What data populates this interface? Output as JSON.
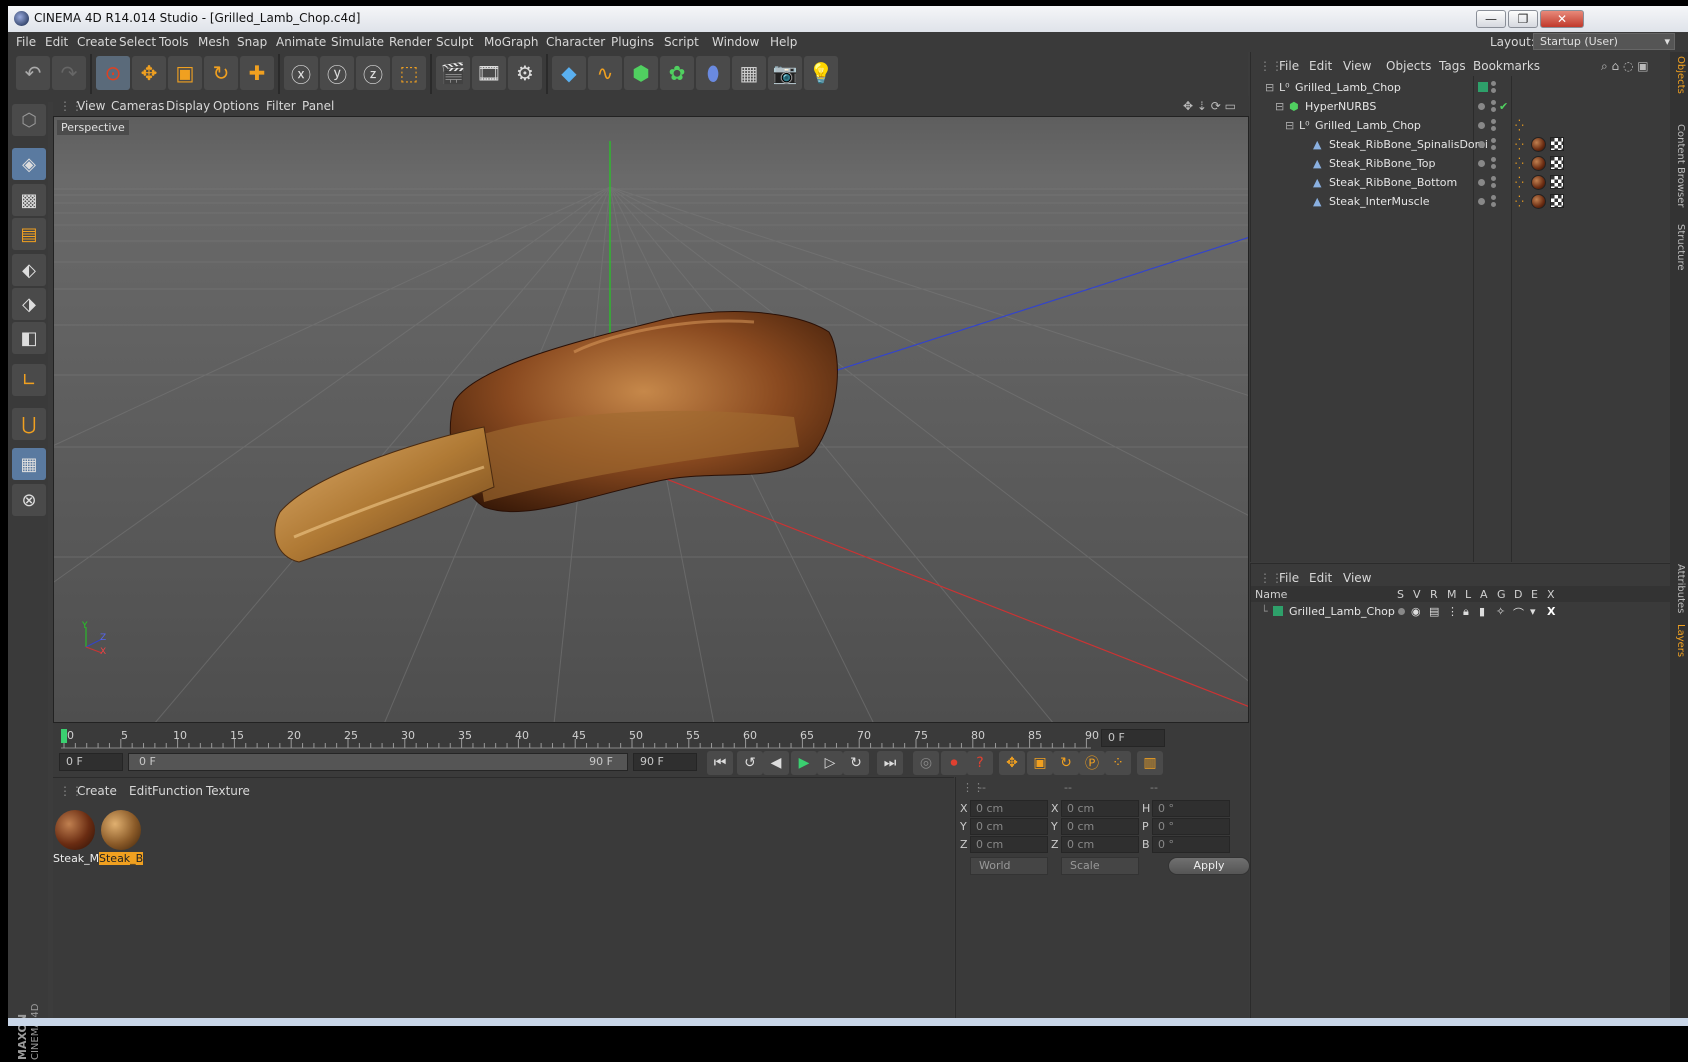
{
  "window": {
    "title": "CINEMA 4D R14.014 Studio - [Grilled_Lamb_Chop.c4d]",
    "min_label": "—",
    "max_label": "❐",
    "close_label": "✕"
  },
  "menu": [
    "File",
    "Edit",
    "Create",
    "Select",
    "Tools",
    "Mesh",
    "Snap",
    "Animate",
    "Simulate",
    "Render",
    "Sculpt",
    "MoGraph",
    "Character",
    "Plugins",
    "Script",
    "Window",
    "Help"
  ],
  "layout": {
    "label": "Layout:",
    "value": "Startup (User)"
  },
  "viewport": {
    "menu": [
      "View",
      "Cameras",
      "Display",
      "Options",
      "Filter",
      "Panel"
    ],
    "label": "Perspective",
    "axis_y": "Y",
    "axis_z": "Z",
    "axis_x": "X"
  },
  "timeline": {
    "ticks": [
      "0",
      "5",
      "10",
      "15",
      "20",
      "25",
      "30",
      "35",
      "40",
      "45",
      "50",
      "55",
      "60",
      "65",
      "70",
      "75",
      "80",
      "85",
      "90"
    ],
    "current_frame": "0 F",
    "start_field": "0 F",
    "range_start": "0 F",
    "range_end": "90 F",
    "end_field": "90 F"
  },
  "material_manager": {
    "menu": [
      "Create",
      "Edit",
      "Function",
      "Texture"
    ],
    "materials": [
      {
        "label": "Steak_M",
        "selected": false
      },
      {
        "label": "Steak_B",
        "selected": true
      }
    ]
  },
  "coordinates": {
    "headers": [
      "--",
      "--",
      "--"
    ],
    "rows": [
      {
        "axis1": "X",
        "v1": "0 cm",
        "axis2": "X",
        "v2": "0 cm",
        "axis3": "H",
        "v3": "0 °"
      },
      {
        "axis1": "Y",
        "v1": "0 cm",
        "axis2": "Y",
        "v2": "0 cm",
        "axis3": "P",
        "v3": "0 °"
      },
      {
        "axis1": "Z",
        "v1": "0 cm",
        "axis2": "Z",
        "v2": "0 cm",
        "axis3": "B",
        "v3": "0 °"
      }
    ],
    "space": "World",
    "mode": "Scale",
    "apply": "Apply"
  },
  "object_manager": {
    "menu": [
      "File",
      "Edit",
      "View",
      "Objects",
      "Tags",
      "Bookmarks"
    ],
    "objects": [
      {
        "name": "Grilled_Lamb_Chop",
        "indent": 0,
        "icon": "null-icon"
      },
      {
        "name": "HyperNURBS",
        "indent": 1,
        "icon": "hypernurbs-icon"
      },
      {
        "name": "Grilled_Lamb_Chop",
        "indent": 2,
        "icon": "null-icon"
      },
      {
        "name": "Steak_RibBone_SpinalisDorsi",
        "indent": 3,
        "icon": "polygon-icon"
      },
      {
        "name": "Steak_RibBone_Top",
        "indent": 3,
        "icon": "polygon-icon"
      },
      {
        "name": "Steak_RibBone_Bottom",
        "indent": 3,
        "icon": "polygon-icon"
      },
      {
        "name": "Steak_InterMuscle",
        "indent": 3,
        "icon": "polygon-icon"
      }
    ]
  },
  "layer_manager": {
    "menu": [
      "File",
      "Edit",
      "View"
    ],
    "columns": [
      "Name",
      "S",
      "V",
      "R",
      "M",
      "L",
      "A",
      "G",
      "D",
      "E",
      "X"
    ],
    "layers": [
      {
        "name": "Grilled_Lamb_Chop",
        "color": "#2ea06a"
      }
    ]
  },
  "side_tabs": [
    "Objects",
    "Content Browser",
    "Structure",
    "Attributes",
    "Layers"
  ],
  "colors": {
    "accent": "#f0a020",
    "background": "#3a3a3a"
  }
}
